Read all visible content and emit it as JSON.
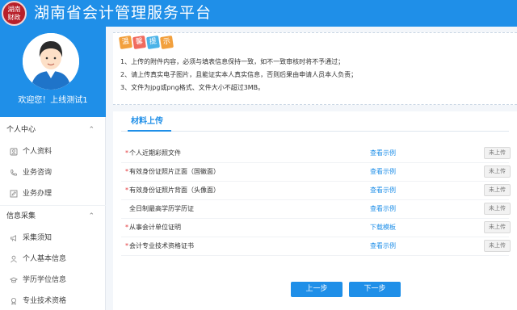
{
  "header": {
    "title": "湖南省会计管理服务平台",
    "logo_text": "湖南财政"
  },
  "sidebar": {
    "welcome": "欢迎您！上线测试1",
    "groups": [
      {
        "label": "个人中心",
        "items": [
          {
            "label": "个人资料",
            "icon": "user-card-icon"
          },
          {
            "label": "业务咨询",
            "icon": "phone-icon"
          },
          {
            "label": "业务办理",
            "icon": "edit-box-icon"
          }
        ]
      },
      {
        "label": "信息采集",
        "items": [
          {
            "label": "采集须知",
            "icon": "megaphone-icon"
          },
          {
            "label": "个人基本信息",
            "icon": "person-icon"
          },
          {
            "label": "学历学位信息",
            "icon": "graduation-icon"
          },
          {
            "label": "专业技术资格",
            "icon": "certificate-icon"
          }
        ]
      }
    ]
  },
  "notice": {
    "badge": [
      "温",
      "馨",
      "提",
      "示"
    ],
    "badge_colors": [
      "#f2a03d",
      "#f06b5e",
      "#4bb3e8",
      "#f2a03d"
    ],
    "lines": [
      "1、上传的附件内容，必须与填表信息保持一致，如不一致审核时将不予通过；",
      "2、请上传真实电子图片，且能证实本人真实信息，否则后果由申请人员本人负责；",
      "3、文件为jpg或png格式、文件大小不超过3MB。"
    ]
  },
  "upload": {
    "title": "材料上传",
    "rows": [
      {
        "required": true,
        "label": "个人近期彩照文件",
        "link": "查看示例",
        "button": "未上传"
      },
      {
        "required": true,
        "label": "有效身份证照片正面（国徽面）",
        "link": "查看示例",
        "button": "未上传"
      },
      {
        "required": true,
        "label": "有效身份证照片背面（头像面）",
        "link": "查看示例",
        "button": "未上传"
      },
      {
        "required": false,
        "label": "全日制最高学历学历证",
        "link": "查看示例",
        "button": "未上传"
      },
      {
        "required": true,
        "label": "从事会计单位证明",
        "link": "下载模板",
        "button": "未上传"
      },
      {
        "required": true,
        "label": "会计专业技术资格证书",
        "link": "查看示例",
        "button": "未上传"
      }
    ],
    "prev_button": "上一步",
    "next_button": "下一步"
  },
  "colors": {
    "primary": "#1f8fe8",
    "required": "#e4393c"
  }
}
